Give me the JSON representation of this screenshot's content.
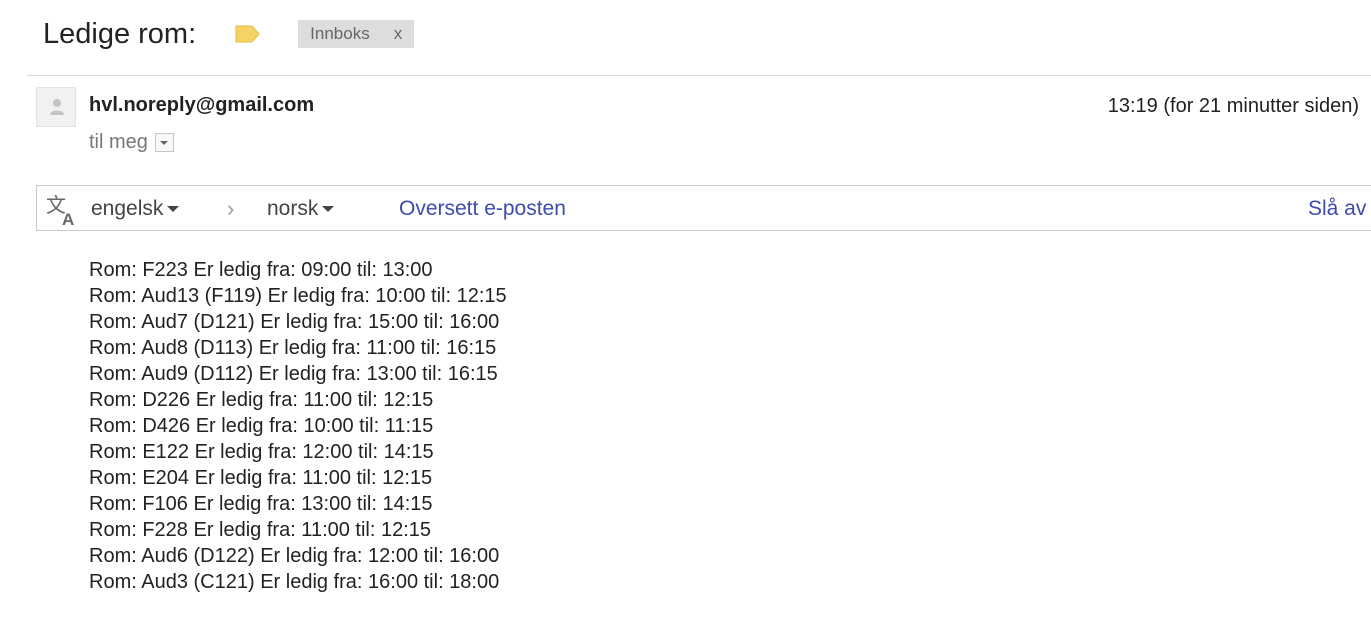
{
  "header": {
    "subject": "Ledige rom:",
    "label_icon": "label-tag-icon",
    "label_chip": "Innboks",
    "label_chip_remove": "x"
  },
  "message": {
    "sender": "hvl.noreply@gmail.com",
    "timestamp": "13:19 (for 21 minutter siden)",
    "recipient": "til meg",
    "avatar_icon": "person-icon",
    "details_icon": "chevron-down-icon"
  },
  "translate_bar": {
    "icon": "translate-icon",
    "from_lang": "engelsk",
    "to_lang": "norsk",
    "separator": "›",
    "translate_link": "Oversett e-posten",
    "turn_off_link": "Slå av"
  },
  "body": {
    "lines": [
      "Rom: F223 Er ledig fra: 09:00 til: 13:00",
      "Rom: Aud13 (F119) Er ledig fra: 10:00 til: 12:15",
      "Rom: Aud7 (D121) Er ledig fra: 15:00 til: 16:00",
      "Rom: Aud8 (D113) Er ledig fra: 11:00 til: 16:15",
      "Rom: Aud9 (D112) Er ledig fra: 13:00 til: 16:15",
      "Rom: D226 Er ledig fra: 11:00 til: 12:15",
      "Rom: D426 Er ledig fra: 10:00 til: 11:15",
      "Rom: E122 Er ledig fra: 12:00 til: 14:15",
      "Rom: E204 Er ledig fra: 11:00 til: 12:15",
      "Rom: F106 Er ledig fra: 13:00 til: 14:15",
      "Rom: F228 Er ledig fra: 11:00 til: 12:15",
      "Rom: Aud6 (D122) Er ledig fra: 12:00 til: 16:00",
      "Rom: Aud3 (C121) Er ledig fra: 16:00 til: 18:00"
    ]
  },
  "colors": {
    "label_tag": "#f6d365",
    "link": "#3c4bb0",
    "chip_bg": "#dddddd"
  }
}
